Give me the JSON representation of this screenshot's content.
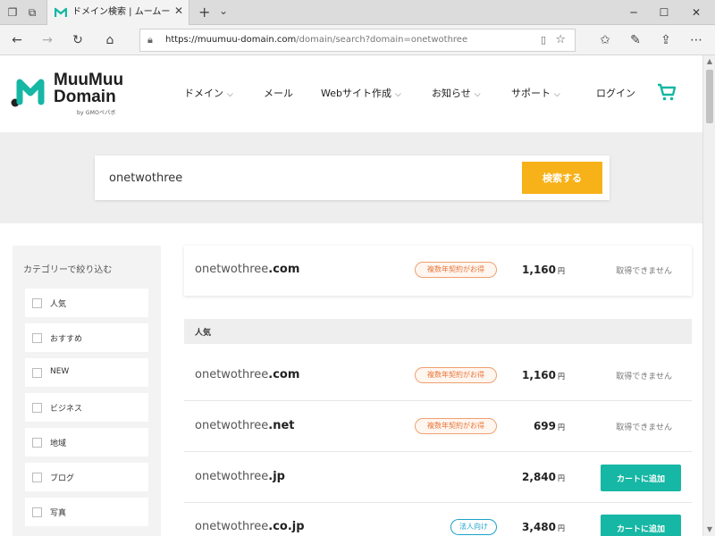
{
  "browser": {
    "tab_title": "ドメイン検索 | ムームードメイ",
    "url_host": "https://muumuu-domain.com",
    "url_path": "/domain/search?domain=onetwothree"
  },
  "site": {
    "logo_line1": "MuuMuu",
    "logo_line2": "Domain",
    "logo_sub": "by GMOペパボ",
    "nav": {
      "domain": "ドメイン",
      "mail": "メール",
      "website": "Webサイト作成",
      "news": "お知らせ",
      "support": "サポート",
      "login": "ログイン"
    },
    "accent": "#16b7a4"
  },
  "search": {
    "value": "onetwothree",
    "button_label": "検索する"
  },
  "sidebar": {
    "title": "カテゴリーで絞り込む",
    "categories": [
      "人気",
      "おすすめ",
      "NEW",
      "ビジネス",
      "地域",
      "ブログ",
      "写真"
    ]
  },
  "featured": {
    "name": "onetwothree",
    "tld": ".com",
    "badge": "複数年契約がお得",
    "price": "1,160",
    "yen": "円",
    "status": "取得できません"
  },
  "section_title": "人気",
  "results": [
    {
      "name": "onetwothree",
      "tld": ".com",
      "badge": "複数年契約がお得",
      "price": "1,160",
      "yen": "円",
      "status": "取得できません"
    },
    {
      "name": "onetwothree",
      "tld": ".net",
      "badge": "複数年契約がお得",
      "price": "699",
      "yen": "円",
      "status": "取得できません"
    },
    {
      "name": "onetwothree",
      "tld": ".jp",
      "price": "2,840",
      "yen": "円",
      "button": "カートに追加"
    },
    {
      "name": "onetwothree",
      "tld": ".co.jp",
      "badge": "法人向け",
      "price": "3,480",
      "yen": "円",
      "button": "カートに追加"
    }
  ]
}
